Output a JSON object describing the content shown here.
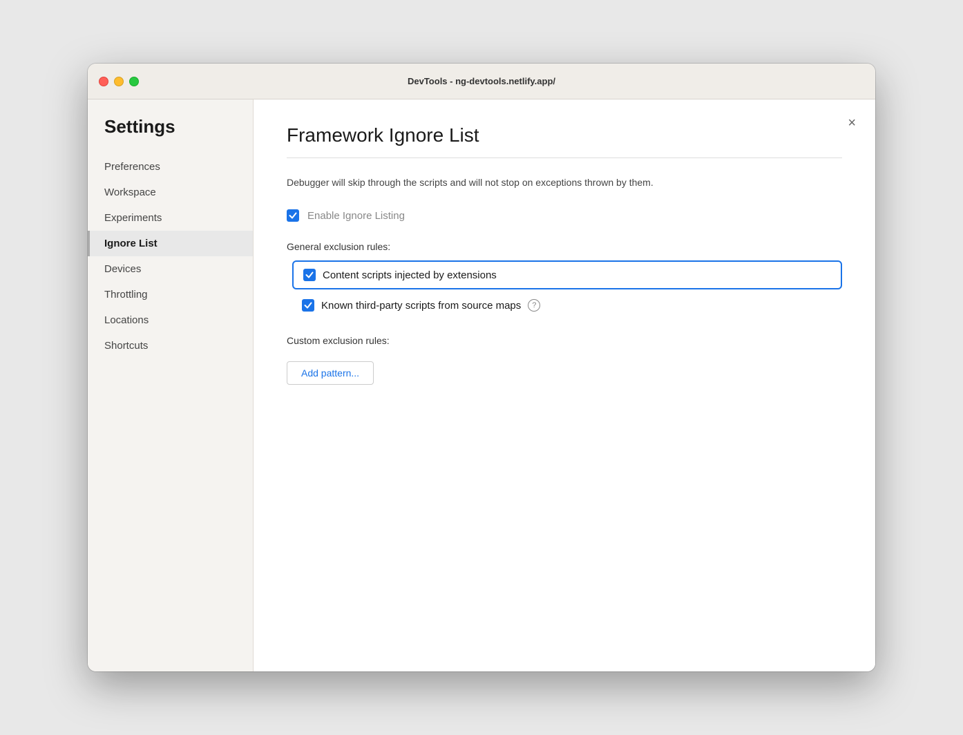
{
  "titlebar": {
    "title": "DevTools - ng-devtools.netlify.app/"
  },
  "sidebar": {
    "heading": "Settings",
    "items": [
      {
        "id": "preferences",
        "label": "Preferences",
        "active": false
      },
      {
        "id": "workspace",
        "label": "Workspace",
        "active": false
      },
      {
        "id": "experiments",
        "label": "Experiments",
        "active": false
      },
      {
        "id": "ignore-list",
        "label": "Ignore List",
        "active": true
      },
      {
        "id": "devices",
        "label": "Devices",
        "active": false
      },
      {
        "id": "throttling",
        "label": "Throttling",
        "active": false
      },
      {
        "id": "locations",
        "label": "Locations",
        "active": false
      },
      {
        "id": "shortcuts",
        "label": "Shortcuts",
        "active": false
      }
    ]
  },
  "content": {
    "title": "Framework Ignore List",
    "description": "Debugger will skip through the scripts and will not stop on\nexceptions thrown by them.",
    "enable_ignore_listing_label": "Enable Ignore Listing",
    "enable_ignore_listing_checked": true,
    "general_exclusion_label": "General exclusion rules:",
    "rules": [
      {
        "id": "content-scripts",
        "label": "Content scripts injected by extensions",
        "checked": true,
        "highlighted": true,
        "has_help": false
      },
      {
        "id": "third-party-scripts",
        "label": "Known third-party scripts from source maps",
        "checked": true,
        "highlighted": false,
        "has_help": true
      }
    ],
    "custom_exclusion_label": "Custom exclusion rules:",
    "add_pattern_label": "Add pattern...",
    "close_label": "×"
  }
}
